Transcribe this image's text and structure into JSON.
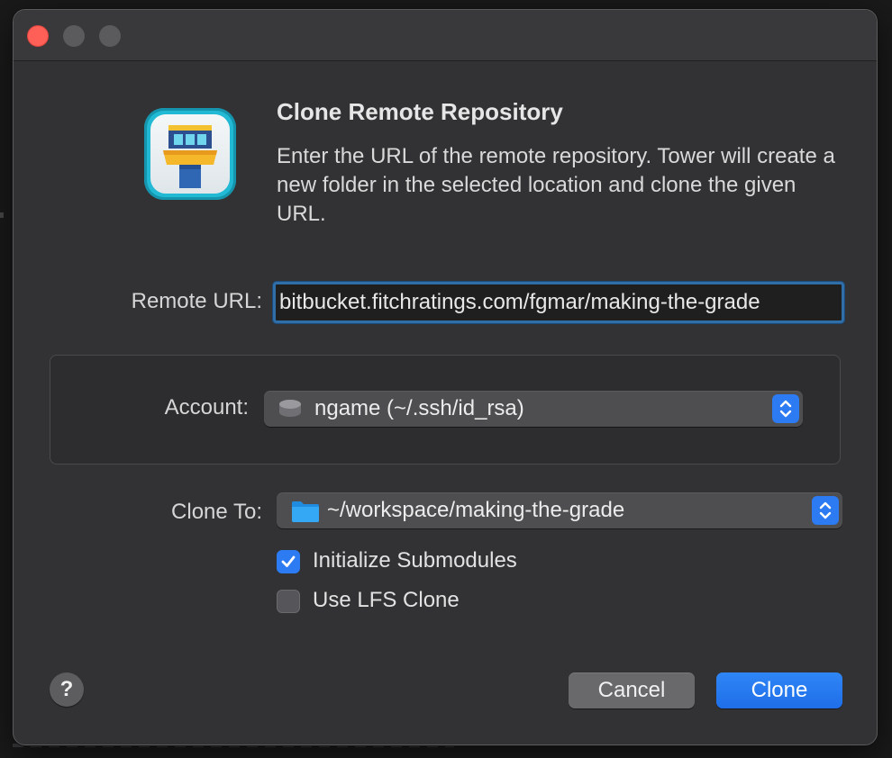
{
  "dialog": {
    "title": "Clone Remote Repository",
    "description": "Enter the URL of the remote repository. Tower will create a new folder in the selected location and clone the given URL.",
    "app_icon": "tower-app-icon"
  },
  "remote_url": {
    "label": "Remote URL:",
    "value": "bitbucket.fitchratings.com/fgmar/making-the-grade"
  },
  "account": {
    "label": "Account:",
    "selected": "ngame (~/.ssh/id_rsa)",
    "icon": "disk-icon"
  },
  "clone_to": {
    "label": "Clone To:",
    "selected": "~/workspace/making-the-grade",
    "icon": "folder-icon"
  },
  "options": {
    "init_submodules": {
      "label": "Initialize Submodules",
      "checked": true
    },
    "use_lfs": {
      "label": "Use LFS Clone",
      "checked": false
    }
  },
  "buttons": {
    "help": "?",
    "cancel": "Cancel",
    "clone": "Clone"
  },
  "colors": {
    "accent": "#2d7bf2",
    "close_button": "#fe5f57",
    "window_bg": "#323234"
  }
}
